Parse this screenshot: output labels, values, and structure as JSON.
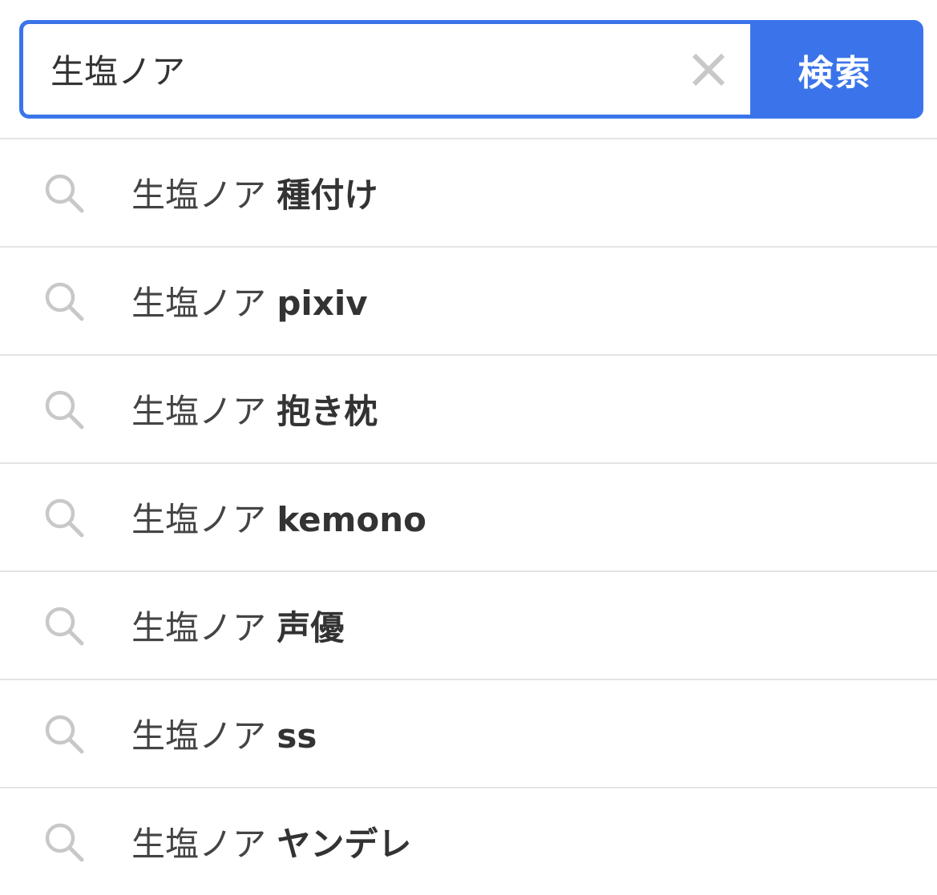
{
  "search": {
    "value": "生塩ノア",
    "button_label": "検索",
    "clear_icon": "close-icon"
  },
  "suggestions": [
    {
      "query": "生塩ノア ",
      "completion": "種付け",
      "icon": "search-icon"
    },
    {
      "query": "生塩ノア ",
      "completion": "pixiv",
      "icon": "search-icon"
    },
    {
      "query": "生塩ノア ",
      "completion": "抱き枕",
      "icon": "search-icon"
    },
    {
      "query": "生塩ノア ",
      "completion": "kemono",
      "icon": "search-icon"
    },
    {
      "query": "生塩ノア ",
      "completion": "声優",
      "icon": "search-icon"
    },
    {
      "query": "生塩ノア ",
      "completion": "ss",
      "icon": "search-icon"
    },
    {
      "query": "生塩ノア ",
      "completion": "ヤンデレ",
      "icon": "search-icon"
    }
  ],
  "colors": {
    "accent": "#3b74ea",
    "icon_gray": "#c8c8c8",
    "divider": "#e4e4e4",
    "text": "#333333"
  }
}
